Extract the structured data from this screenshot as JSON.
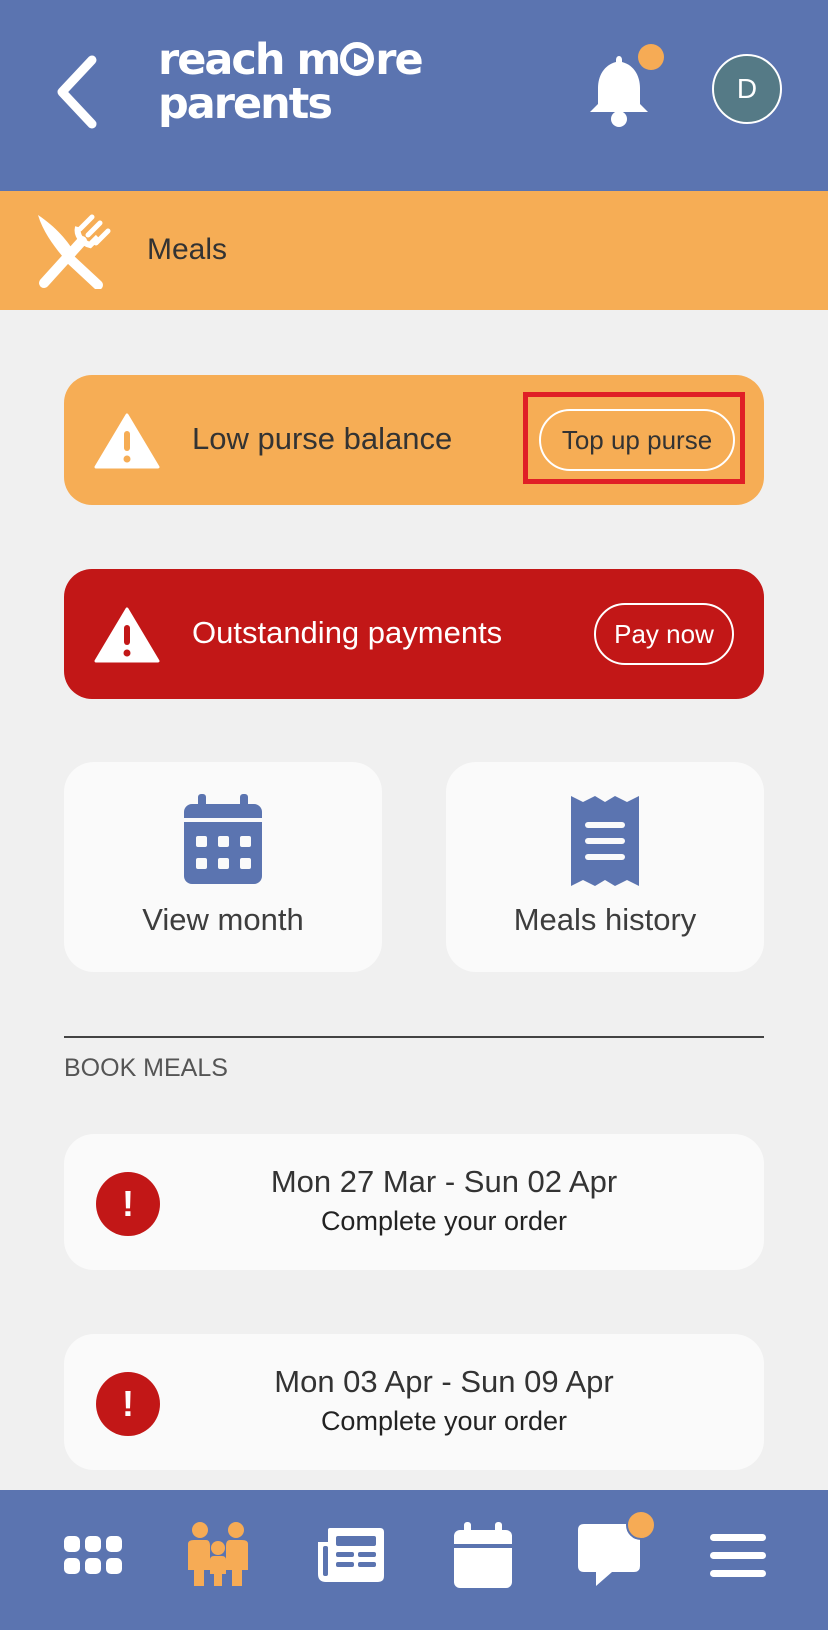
{
  "header": {
    "back_icon": "chevron-left-icon",
    "logo_line1_a": "reach m",
    "logo_line1_b": "re",
    "logo_line2": "parents",
    "avatar_initial": "D"
  },
  "section": {
    "title": "Meals",
    "icon": "cutlery-icon"
  },
  "alerts": [
    {
      "message": "Low purse balance",
      "action": "Top up purse",
      "color": "#f6ad55"
    },
    {
      "message": "Outstanding payments",
      "action": "Pay now",
      "color": "#c21717"
    }
  ],
  "tiles": [
    {
      "label": "View month",
      "icon": "calendar-icon"
    },
    {
      "label": "Meals history",
      "icon": "receipt-icon"
    }
  ],
  "book_meals": {
    "heading": "BOOK MEALS",
    "weeks": [
      {
        "range": "Mon 27 Mar - Sun 02 Apr",
        "status": "Complete your order",
        "badge": "!"
      },
      {
        "range": "Mon 03 Apr - Sun 09 Apr",
        "status": "Complete your order",
        "badge": "!"
      }
    ]
  },
  "bottom_nav": [
    "apps-grid-icon",
    "family-icon",
    "news-icon",
    "calendar-icon",
    "chat-icon",
    "menu-icon"
  ],
  "colors": {
    "brand_blue": "#5b74b0",
    "accent_orange": "#f6ad55",
    "alert_red": "#c21717"
  }
}
